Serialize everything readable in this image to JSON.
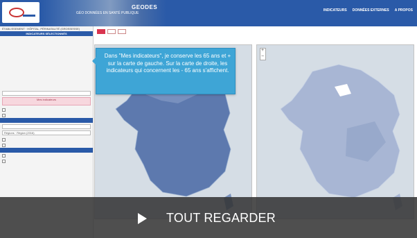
{
  "header": {
    "app_name": "GEODES",
    "app_sub": "GÉO DONNÉES EN SANTÉ PUBLIQUE",
    "nav": [
      "INDICATEURS",
      "DONNÉES EXTERNES",
      "A PROPOS"
    ]
  },
  "sidebar": {
    "rows_top": [
      "ÉTABLISSEMENT · HÔPITAL, PÉRINATALITÉ (GROSSESSE)",
      "",
      "",
      "",
      "",
      "",
      "",
      "",
      "",
      "",
      "",
      ""
    ],
    "head_1": "INDICATEURS SÉLECTIONNÉS",
    "input_1": "",
    "pink_1": "Mes indicateurs",
    "toggles_1": [
      "",
      ""
    ],
    "head_2": "",
    "input_2": "",
    "input_3": "Régions · Région (2016)",
    "toggles_2": [
      "",
      ""
    ],
    "head_3": "",
    "toggles_3": [
      "",
      ""
    ]
  },
  "main": {
    "tabs": [
      "",
      "",
      ""
    ],
    "caption_left": "",
    "caption_right": ""
  },
  "callout": {
    "text": "Dans \"Mes indicateurs\", je conserve les 65 ans et + sur la carte de gauche. Sur la carte de droite, les indicateurs qui concernent les - 65 ans s'affichent."
  },
  "video": {
    "label": "TOUT REGARDER",
    "play_icon": "play-icon"
  },
  "colors": {
    "header": "#2a5aa8",
    "accent": "#d9344f",
    "callout": "#3ea5d6",
    "map_fill": "#7b93be"
  }
}
